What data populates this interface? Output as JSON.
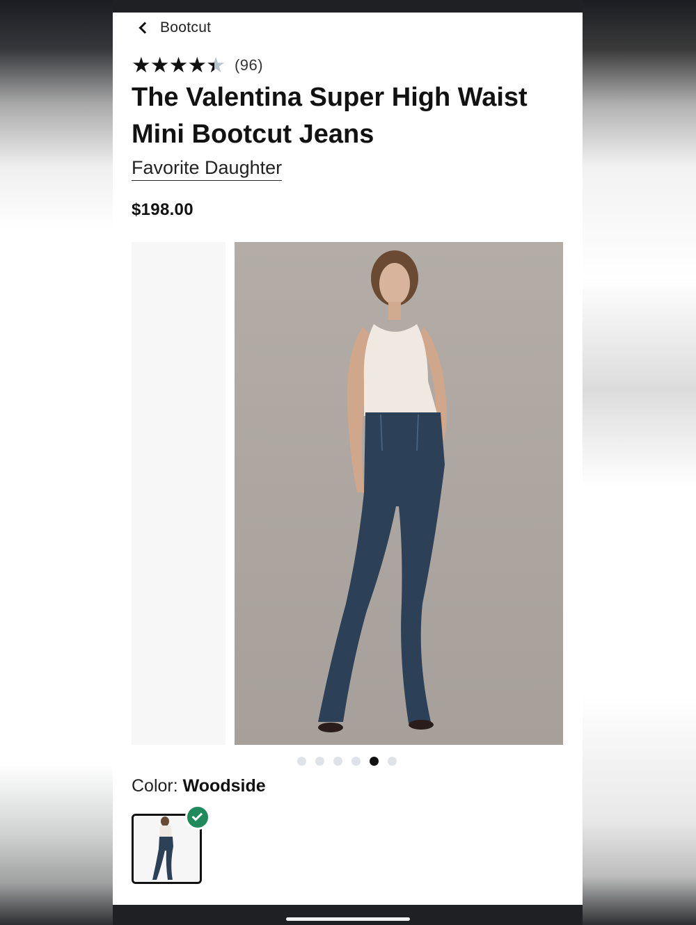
{
  "nav": {
    "back_label": "Bootcut"
  },
  "rating": {
    "value": 4.4,
    "max": 5,
    "count_text": "(96)"
  },
  "product": {
    "title": "The Valentina Super High Waist Mini Bootcut Jeans",
    "brand": "Favorite Daughter",
    "price": "$198.00"
  },
  "gallery": {
    "total": 6,
    "active_index": 4
  },
  "color": {
    "label": "Color:",
    "value": "Woodside"
  },
  "colors": {
    "check_badge": "#1f8a5b",
    "star": "#111111",
    "star_empty": "#b8c4cc"
  }
}
